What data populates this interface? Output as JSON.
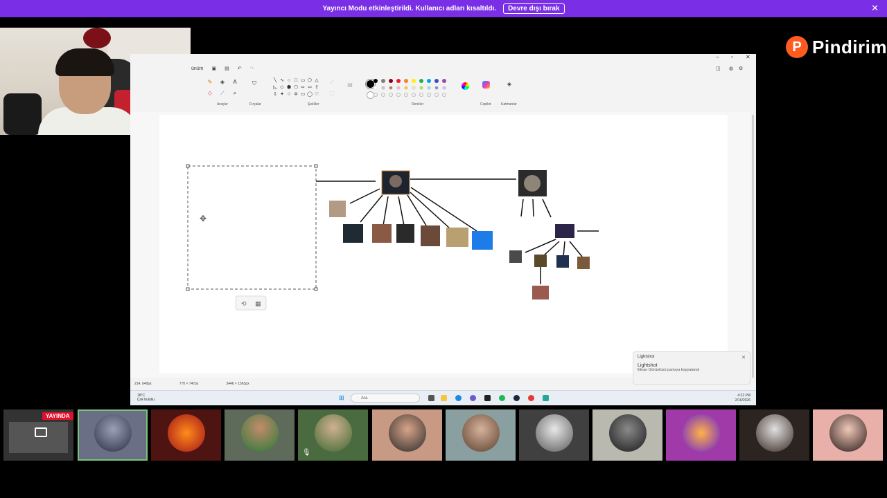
{
  "banner": {
    "message": "Yayıncı Modu etkinleştirildi. Kullanıcı adları kısaltıldı.",
    "button_label": "Devre dışı bırak",
    "close_icon": "close-icon"
  },
  "logo": {
    "badge": "P",
    "text": "Pindirim"
  },
  "paint": {
    "menu_partial": "ünüm",
    "groups": {
      "tools": "Araçlar",
      "brushes": "Fırçalar",
      "shapes": "Şekiller",
      "colors": "Renkler",
      "copilot": "Copilot",
      "layers": "Katmanlar"
    },
    "palette_filled": [
      "#000000",
      "#7f7f7f",
      "#880015",
      "#ed1c24",
      "#ff7f27",
      "#fff200",
      "#22b14c",
      "#00a2e8",
      "#3f48cc",
      "#a349a4"
    ],
    "palette_row2": [
      "#ffffff",
      "#c3c3c3",
      "#b97a57",
      "#ffaec9",
      "#ffc90e",
      "#efe4b0",
      "#b5e61d",
      "#99d9ea",
      "#7092be",
      "#c8bfe7"
    ],
    "status": {
      "cursor_pos": "214, 649px",
      "selection_size": "770 × 747px",
      "canvas_size": "3446 × 1563px"
    }
  },
  "toast": {
    "source": "Lightshot",
    "app": "Lightshot",
    "message": "Ekran Görüntüsü panoya kopyalandı"
  },
  "taskbar": {
    "temperature": "18°C",
    "weather": "Çok bulutlu",
    "search_placeholder": "Ara",
    "time": "4:22 PM",
    "date": "2/16/2026"
  },
  "participants": {
    "live_badge": "YAYINDA"
  }
}
